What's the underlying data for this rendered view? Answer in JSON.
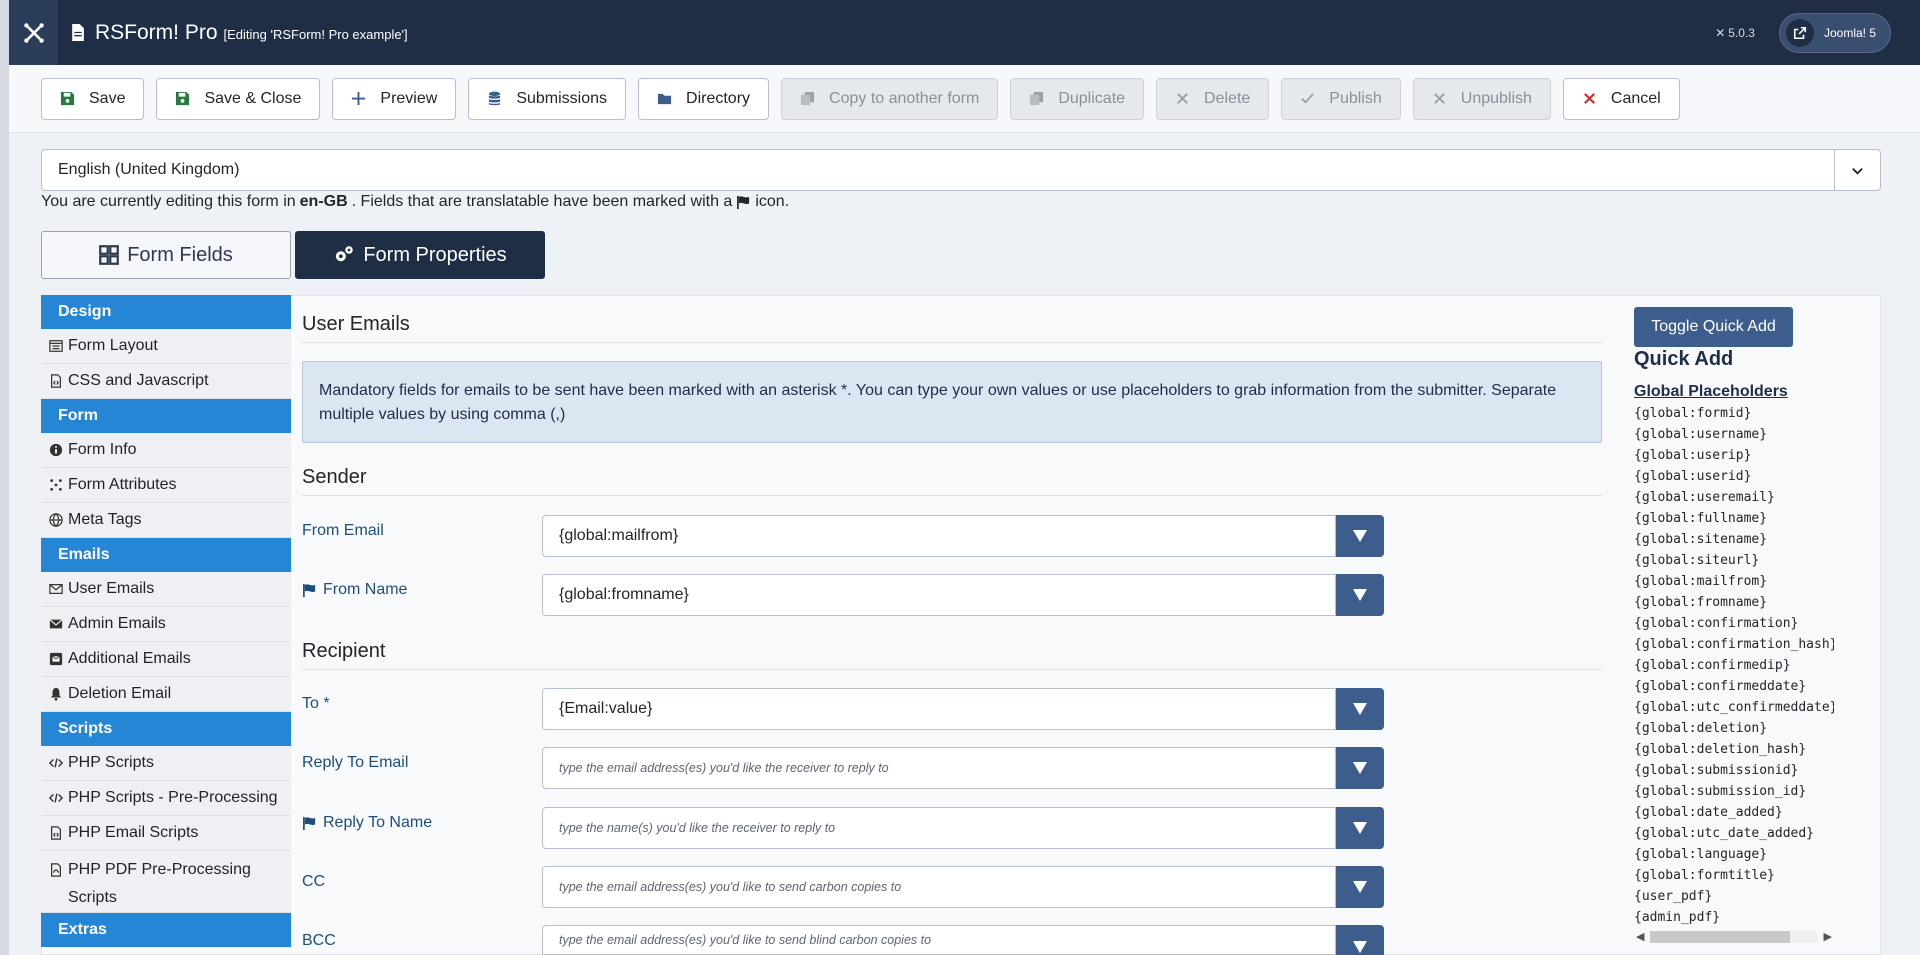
{
  "header": {
    "app_title": "RSForm! Pro",
    "subtitle": "[Editing 'RSForm! Pro example']",
    "version": "5.0.3",
    "joomla_link": "Joomla! 5"
  },
  "toolbar": {
    "save": "Save",
    "save_close": "Save & Close",
    "preview": "Preview",
    "submissions": "Submissions",
    "directory": "Directory",
    "copy": "Copy to another form",
    "duplicate": "Duplicate",
    "delete": "Delete",
    "publish": "Publish",
    "unpublish": "Unpublish",
    "cancel": "Cancel"
  },
  "language": {
    "selected": "English (United Kingdom)",
    "note_prefix": "You are currently editing this form in ",
    "note_lang": "en-GB",
    "note_mid": ". Fields that are translatable have been marked with a ",
    "note_suffix": " icon."
  },
  "tabs": {
    "fields": "Form Fields",
    "properties": "Form Properties"
  },
  "sidebar": {
    "design": "Design",
    "form_layout": "Form Layout",
    "css_js": "CSS and Javascript",
    "form": "Form",
    "form_info": "Form Info",
    "form_attributes": "Form Attributes",
    "meta_tags": "Meta Tags",
    "emails": "Emails",
    "user_emails": "User Emails",
    "admin_emails": "Admin Emails",
    "additional_emails": "Additional Emails",
    "deletion_email": "Deletion Email",
    "scripts": "Scripts",
    "php_scripts": "PHP Scripts",
    "php_pre": "PHP Scripts - Pre-Processing",
    "php_email": "PHP Email Scripts",
    "php_pdf": "PHP PDF Pre-Processing Scripts",
    "extras": "Extras"
  },
  "content": {
    "title": "User Emails",
    "alert": "Mandatory fields for emails to be sent have been marked with an asterisk *. You can type your own values or use placeholders to grab information from the submitter. Separate multiple values by using comma (,)",
    "sender": "Sender",
    "recipient": "Recipient",
    "from_email_label": "From Email",
    "from_email_value": "{global:mailfrom}",
    "from_name_label": "From Name",
    "from_name_value": "{global:fromname}",
    "to_label": "To *",
    "to_value": "{Email:value}",
    "reply_email_label": "Reply To Email",
    "reply_email_ph": "type the email address(es) you'd like the receiver to reply to",
    "reply_name_label": "Reply To Name",
    "reply_name_ph": "type the name(s) you'd like the receiver to reply to",
    "cc_label": "CC",
    "cc_ph": "type the email address(es) you'd like to send carbon copies to",
    "bcc_label": "BCC",
    "bcc_ph": "type the email address(es) you'd like to send blind carbon copies to"
  },
  "quick_add": {
    "toggle": "Toggle Quick Add",
    "title": "Quick Add",
    "subtitle": "Global Placeholders",
    "items": [
      "{global:formid}",
      "{global:username}",
      "{global:userip}",
      "{global:userid}",
      "{global:useremail}",
      "{global:fullname}",
      "{global:sitename}",
      "{global:siteurl}",
      "{global:mailfrom}",
      "{global:fromname}",
      "{global:confirmation}",
      "{global:confirmation_hash}",
      "{global:confirmedip}",
      "{global:confirmeddate}",
      "{global:utc_confirmeddate}",
      "{global:deletion}",
      "{global:deletion_hash}",
      "{global:submissionid}",
      "{global:submission_id}",
      "{global:date_added}",
      "{global:utc_date_added}",
      "{global:language}",
      "{global:formtitle}",
      "{user_pdf}",
      "{admin_pdf}"
    ]
  }
}
